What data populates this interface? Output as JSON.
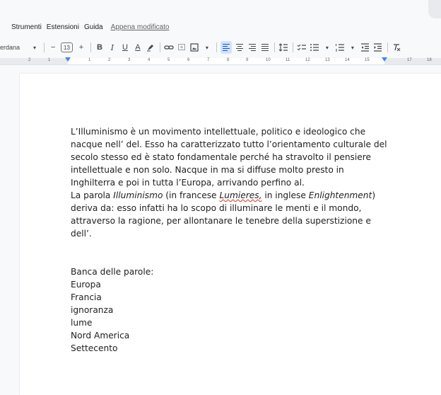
{
  "menubar": {
    "items": [
      "Strumenti",
      "Estensioni",
      "Guida"
    ],
    "last_edit": "Appena modificato"
  },
  "toolbar": {
    "font": "erdana",
    "minus": "−",
    "font_size": "13",
    "plus": "+",
    "bold": "B",
    "italic": "I",
    "underline": "U",
    "text_color": "A"
  },
  "ruler": {
    "labels": [
      "2",
      "1",
      "1",
      "2",
      "3",
      "4",
      "5",
      "6",
      "7",
      "8",
      "9",
      "10",
      "11",
      "12",
      "13",
      "14",
      "15",
      "17",
      "18"
    ]
  },
  "document": {
    "p1": "L’Illuminismo è un movimento intellettuale, politico e ideologico che nacque nell’ del. Esso ha caratterizzato tutto l’orientamento culturale del secolo stesso ed è stato fondamentale perché ha stravolto il pensiere intellettuale e non solo. Nacque in ma si diffuse molto presto in Inghilterra e poi in tutta l’Europa, arrivando perfino al.",
    "p2_a": "La parola ",
    "p2_term": "Illuminismo",
    "p2_b": " (in francese ",
    "p2_fr": "Lumieres,",
    "p2_c": " in inglese ",
    "p2_en": "Enlightenment",
    "p2_d": ") deriva da: esso infatti ha lo scopo di illuminare le menti e il mondo, attraverso la ragione, per allontanare le tenebre della superstizione e dell’.",
    "bank_title": "Banca delle parole:",
    "bank_words": [
      "Europa",
      "Francia",
      "ignoranza",
      "lume",
      "Nord America",
      "Settecento"
    ]
  },
  "colors": {
    "accent": "#0b57d0",
    "active_bg": "#d3e3fd",
    "spell_error": "#d93025"
  }
}
